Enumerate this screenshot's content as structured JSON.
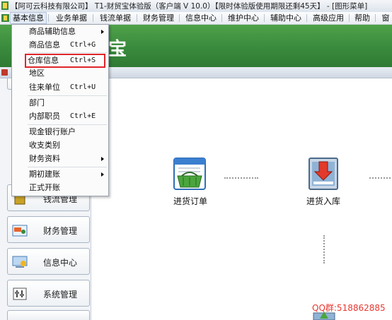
{
  "window": {
    "title": "【阿可云科技有限公司】 T1-财贸宝体验版（客户端 V 10.0）【限时体验版使用期限还剩45天】 - [图形菜单]"
  },
  "menubar": {
    "items": [
      {
        "label": "基本信息"
      },
      {
        "label": "业务单据"
      },
      {
        "label": "钱流单据"
      },
      {
        "label": "财务管理"
      },
      {
        "label": "信息中心"
      },
      {
        "label": "维护中心"
      },
      {
        "label": "辅助中心"
      },
      {
        "label": "高级应用"
      },
      {
        "label": "帮助"
      },
      {
        "label": "窗"
      }
    ]
  },
  "banner": {
    "logo_text": "宝"
  },
  "dropdown": {
    "items": [
      {
        "label": "商品辅助信息",
        "shortcut": "",
        "submenu": true
      },
      {
        "label": "商品信息",
        "shortcut": "Ctrl+G",
        "submenu": false
      },
      {
        "label": "仓库信息",
        "shortcut": "Ctrl+S",
        "submenu": false,
        "highlighted": true
      },
      {
        "label": "地区",
        "shortcut": "",
        "submenu": false
      },
      {
        "label": "往来单位",
        "shortcut": "Ctrl+U",
        "submenu": false
      },
      {
        "label": "部门",
        "shortcut": "",
        "submenu": false
      },
      {
        "label": "内部职员",
        "shortcut": "Ctrl+E",
        "submenu": false
      },
      {
        "label": "现金银行账户",
        "shortcut": "",
        "submenu": false
      },
      {
        "label": "收支类别",
        "shortcut": "",
        "submenu": false
      },
      {
        "label": "财务资料",
        "shortcut": "",
        "submenu": true
      },
      {
        "label": "期初建账",
        "shortcut": "",
        "submenu": true
      },
      {
        "label": "正式开账",
        "shortcut": "",
        "submenu": false
      }
    ]
  },
  "leftnav": {
    "items": [
      {
        "label": "钱流管理"
      },
      {
        "label": "财务管理"
      },
      {
        "label": "信息中心"
      },
      {
        "label": "系统管理"
      }
    ]
  },
  "flow": {
    "nodes": [
      {
        "label": "进货订单"
      },
      {
        "label": "进货入库"
      }
    ]
  },
  "watermark": {
    "text": "QQ群:518862885"
  },
  "colors": {
    "banner": "#3a8a3d",
    "highlight_border": "#e0262b",
    "watermark": "#e8382f"
  }
}
